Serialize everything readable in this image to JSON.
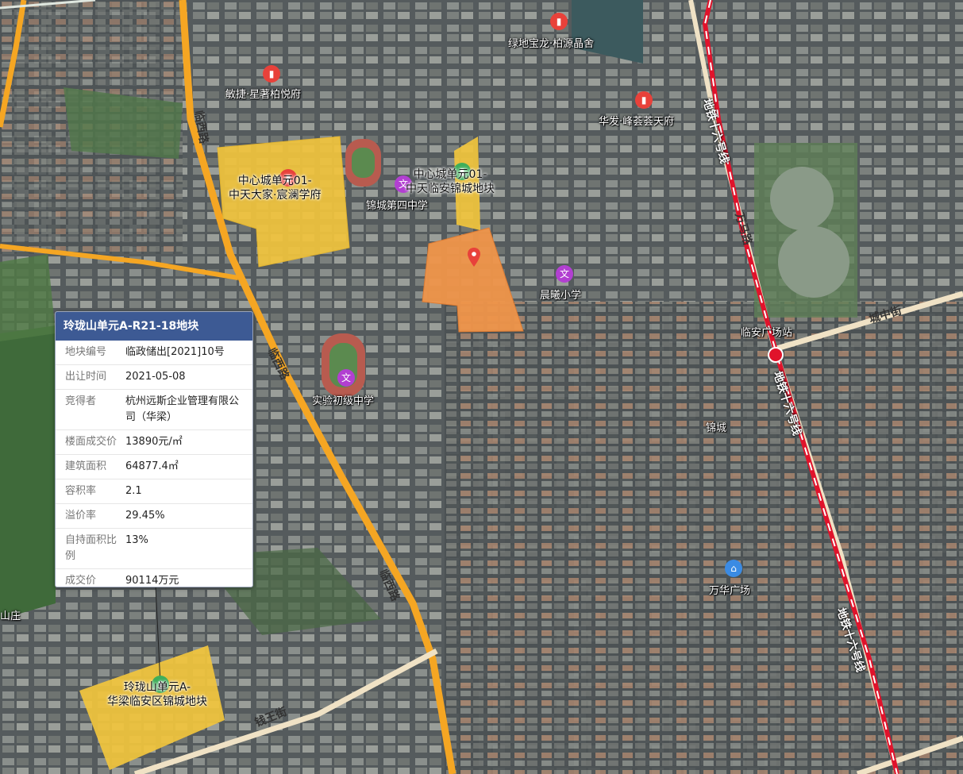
{
  "info_panel": {
    "title": "玲珑山单元A-R21-18地块",
    "rows": [
      {
        "label": "地块编号",
        "value": "临政储出[2021]10号"
      },
      {
        "label": "出让时间",
        "value": "2021-05-08"
      },
      {
        "label": "竞得者",
        "value": "杭州远斯企业管理有限公司（华梁）"
      },
      {
        "label": "楼面成交价",
        "value": "13890元/㎡"
      },
      {
        "label": "建筑面积",
        "value": "64877.4㎡"
      },
      {
        "label": "容积率",
        "value": "2.1"
      },
      {
        "label": "溢价率",
        "value": "29.45%"
      },
      {
        "label": "自持面积比例",
        "value": "13%"
      },
      {
        "label": "成交价",
        "value": "90114万元"
      }
    ]
  },
  "parcels": [
    {
      "line1": "中心城单元01-",
      "line2": "中天大家·宸澜学府"
    },
    {
      "line1": "中心城单元01-",
      "line2": "中天临安锦城地块"
    },
    {
      "line1": "玲珑山单元A-",
      "line2": "华梁临安区锦城地块"
    }
  ],
  "pois": {
    "lvdi": "绿地宝龙·柏源晶舍",
    "minjie": "敏捷·星著柏悦府",
    "huafa": "华发·峰荟荟天府",
    "jincheng4": "锦城第四中学",
    "chenxi": "晨曦小学",
    "shiyan": "实验初级中学",
    "wanhua": "万华广场",
    "guangchang_station": "临安广场站",
    "jincheng": "锦城",
    "shanzhuang": "山庄"
  },
  "roads": {
    "linxi1": "临西路",
    "linxi2": "临西路",
    "linxi3": "临西路",
    "wanma": "万马路",
    "chengzhong": "城中街",
    "qianwang": "钱王街"
  },
  "metro": {
    "line_name1": "地铁十六号线",
    "line_name2": "地铁十六号线",
    "line_name3": "地铁十六号线",
    "color": "#e0132b"
  },
  "colors": {
    "parcel_yellow": "#f2c53d",
    "parcel_selected": "#f0954a",
    "road": "#f5a623",
    "panel_header": "#3d5a94"
  },
  "icons": {
    "school": "文",
    "shopping": "shopping-bag-icon",
    "building": "building-pin-icon"
  }
}
